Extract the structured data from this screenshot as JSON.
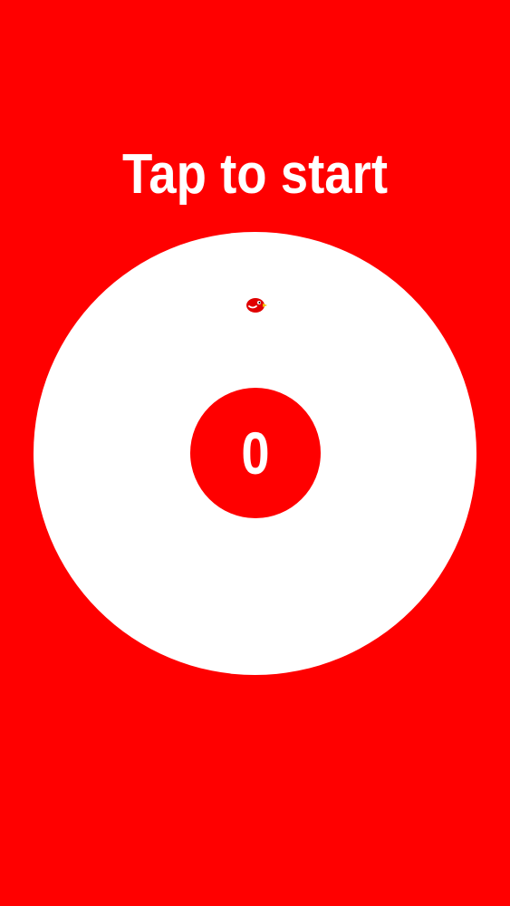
{
  "colors": {
    "background": "#ff0000",
    "ring": "#ffffff",
    "score_disc": "#ff0000",
    "text": "#ffffff",
    "bird_body": "#e00000",
    "bird_beak": "#f2c200"
  },
  "game": {
    "prompt": "Tap to start",
    "score": "0"
  },
  "player": {
    "icon": "bird-icon"
  }
}
